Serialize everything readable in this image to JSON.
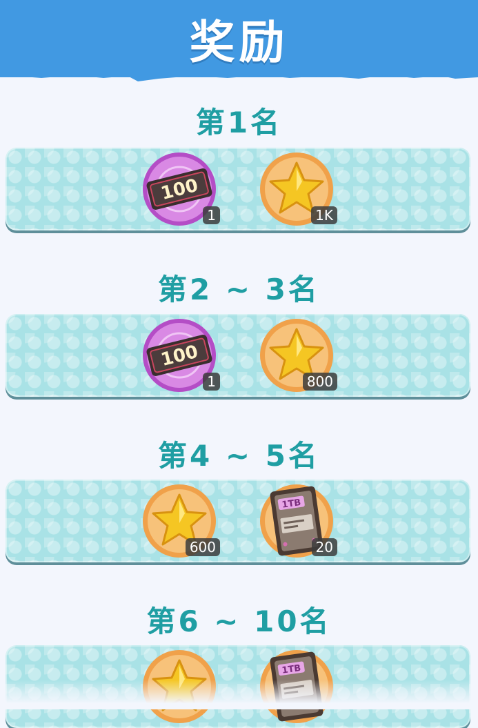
{
  "header": {
    "title": "奖励"
  },
  "tiers": [
    {
      "rank": "第1名",
      "items": [
        {
          "icon": "ticket-100-icon",
          "ticket_text": "100",
          "count": "1"
        },
        {
          "icon": "star-coin-icon",
          "count": "1K"
        }
      ]
    },
    {
      "rank": "第2 ~ 3名",
      "items": [
        {
          "icon": "ticket-100-icon",
          "ticket_text": "100",
          "count": "1"
        },
        {
          "icon": "star-coin-icon",
          "count": "800"
        }
      ]
    },
    {
      "rank": "第4 ~ 5名",
      "items": [
        {
          "icon": "star-coin-icon",
          "count": "600"
        },
        {
          "icon": "hard-drive-icon",
          "drive_text": "1TB",
          "count": "20"
        }
      ]
    },
    {
      "rank": "第6 ~ 10名",
      "items": [
        {
          "icon": "star-coin-icon",
          "count": ""
        },
        {
          "icon": "hard-drive-icon",
          "drive_text": "1TB",
          "count": ""
        }
      ]
    }
  ]
}
